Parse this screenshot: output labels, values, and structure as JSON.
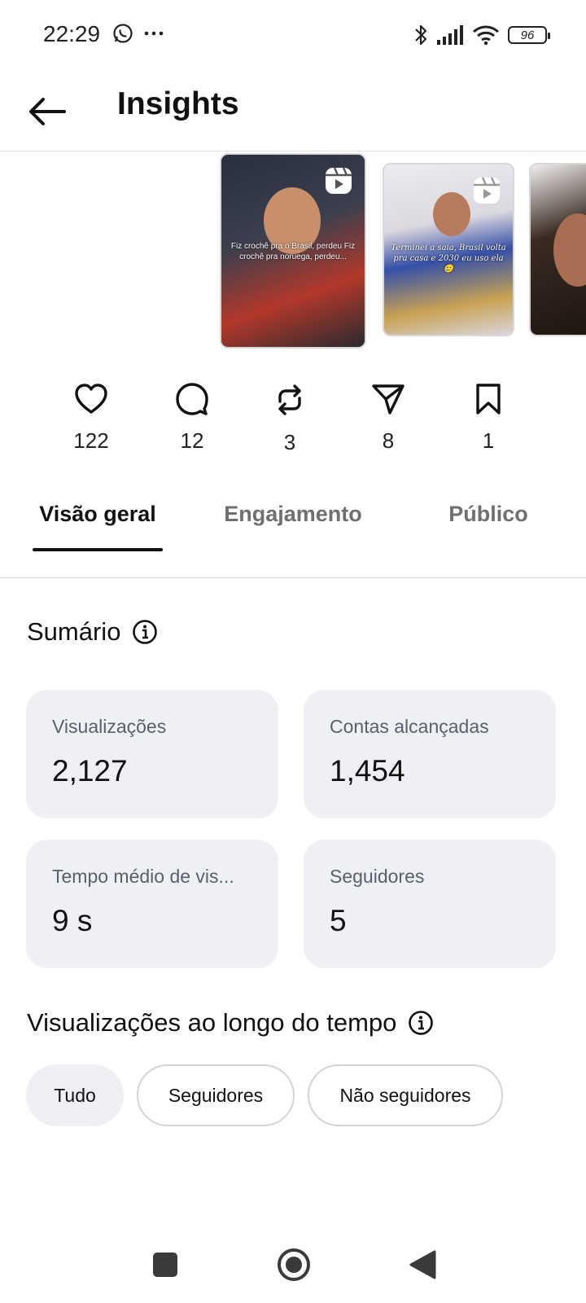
{
  "status_bar": {
    "time": "22:29",
    "left_icons": [
      "whatsapp-icon",
      "more-icon"
    ],
    "right_icons": [
      "bluetooth-icon",
      "signal-icon",
      "wifi-icon",
      "battery-icon"
    ],
    "battery_level": "96"
  },
  "header": {
    "title": "Insights",
    "back_icon": "arrow-left-icon"
  },
  "carousel": {
    "items": [
      {
        "caption": "Fiz crochê pra o Brasil, perdeu Fiz crochê pra noruega, perdeu...",
        "icon": "reels-icon"
      },
      {
        "caption": "Terminei a saia, Brasil volta pra casa e 2030 eu uso ela 🥲",
        "icon": "reels-icon"
      },
      {
        "caption": "",
        "icon": ""
      }
    ]
  },
  "stats": {
    "likes": "122",
    "comments": "12",
    "reposts": "3",
    "shares": "8",
    "saves": "1"
  },
  "tabs": {
    "overview": "Visão geral",
    "engagement": "Engajamento",
    "audience": "Público"
  },
  "summary": {
    "title": "Sumário",
    "cards": {
      "views": {
        "label": "Visualizações",
        "value": "2,127"
      },
      "reach": {
        "label": "Contas alcançadas",
        "value": "1,454"
      },
      "avg_time": {
        "label": "Tempo médio de vis...",
        "value": "9 s"
      },
      "followers": {
        "label": "Seguidores",
        "value": "5"
      }
    }
  },
  "timeline": {
    "title": "Visualizações ao longo do tempo",
    "chips": {
      "all": "Tudo",
      "followers": "Seguidores",
      "non_followers": "Não seguidores"
    },
    "selected_chip": "Tudo"
  },
  "colors": {
    "card_bg": "#eff0f4",
    "text_primary": "#111111",
    "text_secondary": "#5a5f6b",
    "tab_inactive": "#6f6f6f"
  }
}
